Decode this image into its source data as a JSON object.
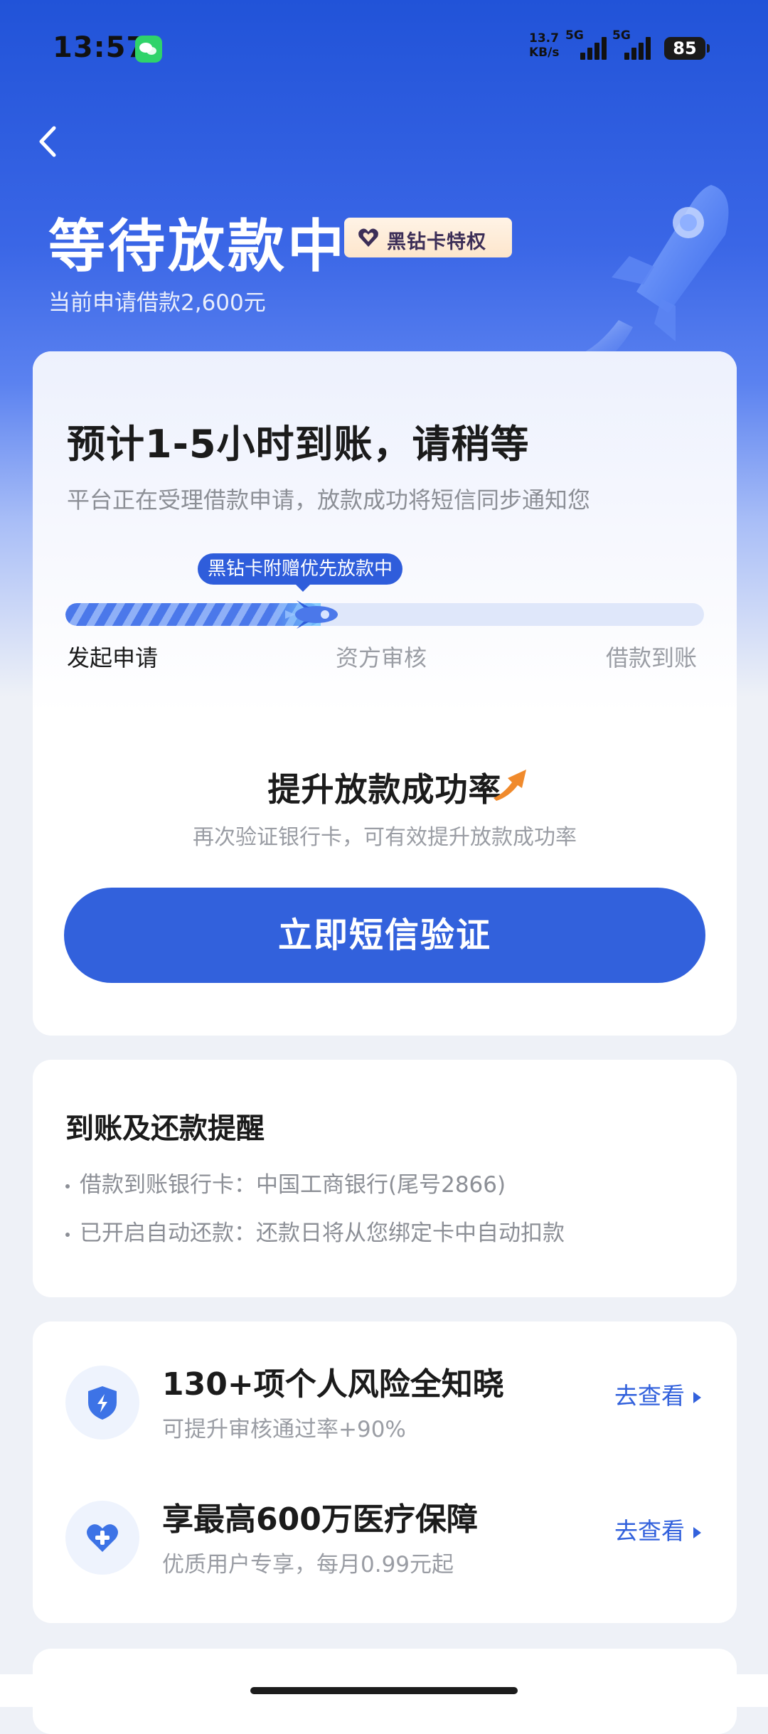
{
  "status_bar": {
    "time": "13:57",
    "net_speed_value": "13.7",
    "net_speed_unit": "KB/s",
    "sim1_label": "5G",
    "sim2_label": "5G",
    "battery": "85"
  },
  "header": {
    "title": "等待放款中",
    "badge": "黑钻卡特权",
    "subtitle": "当前申请借款2,600元"
  },
  "status_card": {
    "eta_title": "预计1-5小时到账，请稍等",
    "eta_desc": "平台正在受理借款申请，放款成功将短信同步通知您",
    "progress_tag": "黑钻卡附赠优先放款中",
    "progress_fraction": 0.4,
    "steps": [
      "发起申请",
      "资方审核",
      "借款到账"
    ],
    "boost_title": "提升放款成功率",
    "boost_desc": "再次验证银行卡，可有效提升放款成功率",
    "verify_button": "立即短信验证"
  },
  "reminder": {
    "title": "到账及还款提醒",
    "items": [
      "借款到账银行卡：中国工商银行(尾号2866)",
      "已开启自动还款：还款日将从您绑定卡中自动扣款"
    ]
  },
  "services": [
    {
      "title": "130+项个人风险全知晓",
      "subtitle": "可提升审核通过率+90%",
      "link": "去查看",
      "icon": "shield-icon"
    },
    {
      "title": "享最高600万医疗保障",
      "subtitle": "优质用户专享，每月0.99元起",
      "link": "去查看",
      "icon": "heart-plus-icon"
    }
  ],
  "colors": {
    "primary": "#3261dc",
    "header_bg": "#2153d8",
    "badge_bg": "#fde6cc"
  }
}
